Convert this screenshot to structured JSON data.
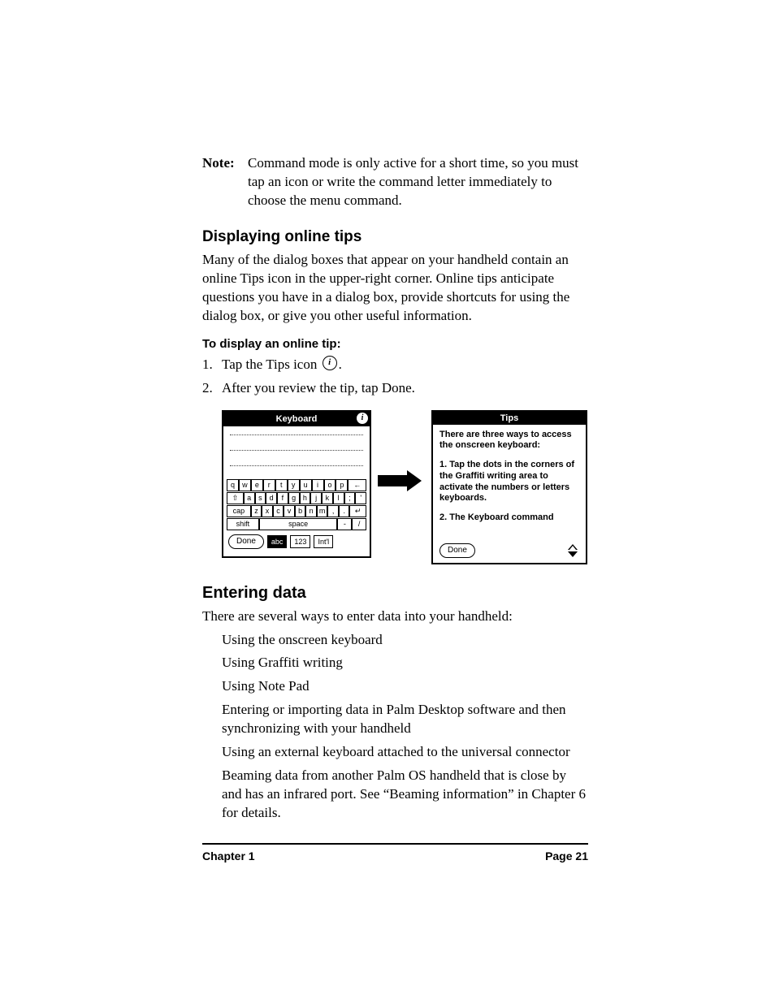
{
  "note": {
    "label": "Note:",
    "body": "Command mode is only active for a short time, so you must tap an icon or write the command letter immediately to choose the menu command."
  },
  "sec1": {
    "heading": "Displaying online tips",
    "para": "Many of the dialog boxes that appear on your handheld contain an online Tips icon in the upper-right corner. Online tips anticipate questions you have in a dialog box, provide shortcuts for using the dialog box, or give you other useful information.",
    "sub": "To display an online tip:",
    "step1_n": "1.",
    "step1_a": "Tap the Tips icon ",
    "step1_b": ".",
    "step2_n": "2.",
    "step2": "After you review the tip, tap Done."
  },
  "kb": {
    "title": "Keyboard",
    "row1": [
      "q",
      "w",
      "e",
      "r",
      "t",
      "y",
      "u",
      "i",
      "o",
      "p",
      "←"
    ],
    "row2": [
      "⇧",
      "a",
      "s",
      "d",
      "f",
      "g",
      "h",
      "j",
      "k",
      "l",
      ";",
      "'"
    ],
    "row3": [
      "cap",
      "z",
      "x",
      "c",
      "v",
      "b",
      "n",
      "m",
      ",",
      ".",
      "↵"
    ],
    "row4_shift": "shift",
    "row4_space": "space",
    "row4_dash": "-",
    "row4_slash": "/",
    "done": "Done",
    "abc": "abc",
    "num": "123",
    "intl": "Int'l"
  },
  "tips": {
    "title": "Tips",
    "p0": "There are three ways to access the onscreen keyboard:",
    "p1": "1. Tap the dots in the corners of the Graffiti writing area to activate the numbers or letters keyboards.",
    "p2": "2. The Keyboard command",
    "done": "Done"
  },
  "sec2": {
    "heading": "Entering data",
    "para": "There are several ways to enter data into your handheld:",
    "items": [
      "Using the onscreen keyboard",
      "Using Graffiti writing",
      "Using Note Pad",
      "Entering or importing data in Palm Desktop software and then synchronizing with your handheld",
      "Using an external keyboard attached to the universal connector",
      "Beaming data from another Palm OS handheld that is close by and has an infrared port. See “Beaming information” in Chapter 6 for details."
    ]
  },
  "footer": {
    "left": "Chapter 1",
    "right": "Page 21"
  }
}
